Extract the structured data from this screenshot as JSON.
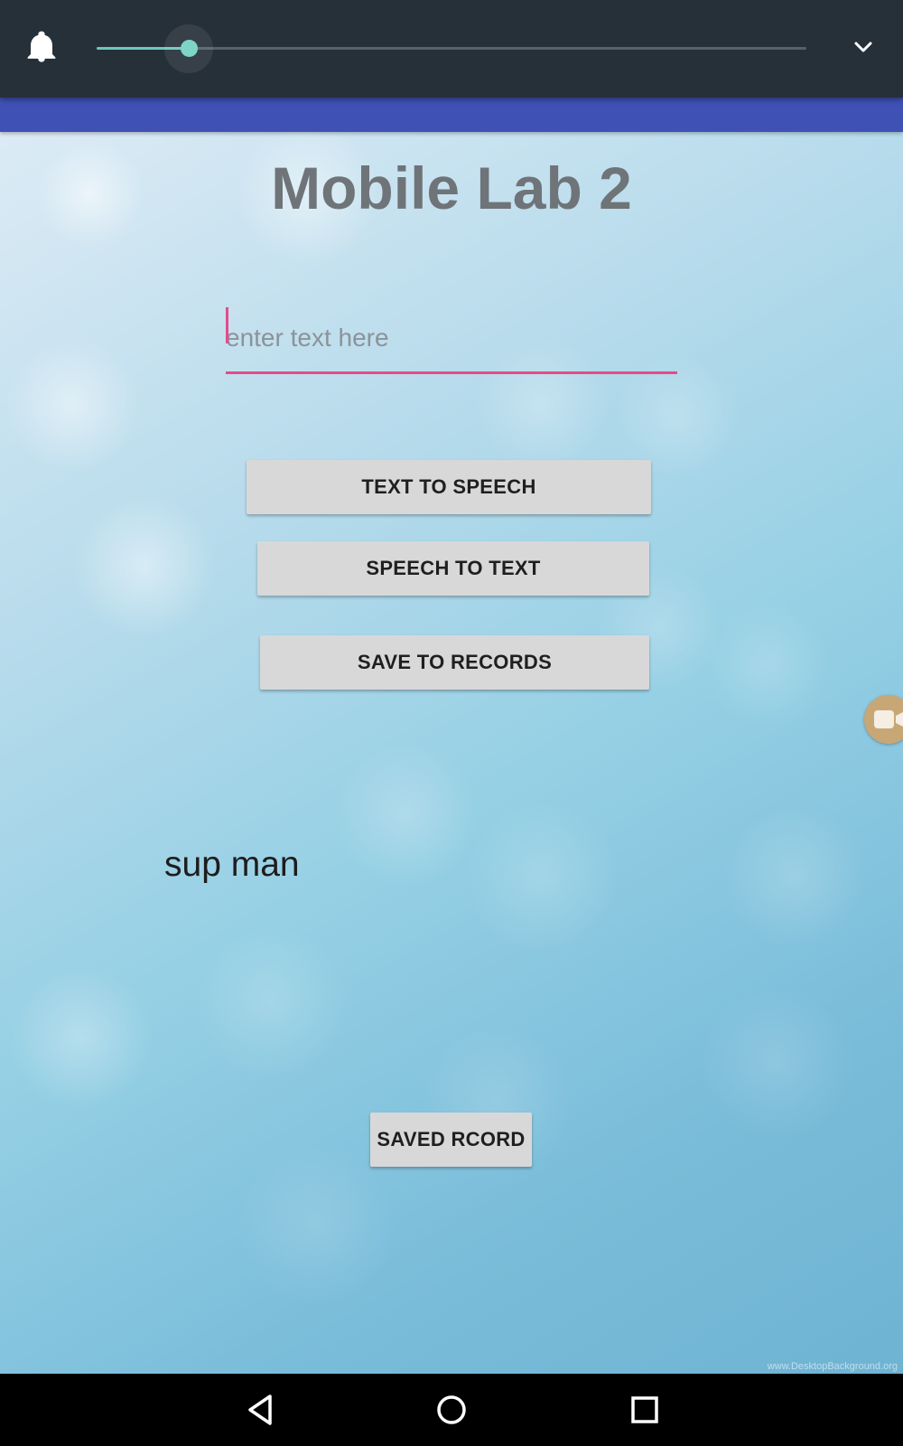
{
  "volume_panel": {
    "level": 0.13,
    "icons": {
      "left": "bell-icon",
      "right": "chevron-down-icon"
    },
    "accent_color": "#7fd4c8"
  },
  "app": {
    "title": "Mobile Lab 2",
    "input": {
      "value": "",
      "placeholder": "enter text here"
    },
    "buttons": {
      "text_to_speech": "TEXT TO SPEECH",
      "speech_to_text": "SPEECH TO TEXT",
      "save_to_records": "SAVE TO RECORDS",
      "saved_record": "SAVED RCORD"
    },
    "result_text": "sup man",
    "watermark": "www.DesktopBackground.org",
    "colors": {
      "action_bar": "#3f51b5",
      "input_underline": "#e54b8a"
    }
  },
  "nav_bar": {
    "icons": [
      "back-icon",
      "home-icon",
      "recent-apps-icon"
    ]
  }
}
